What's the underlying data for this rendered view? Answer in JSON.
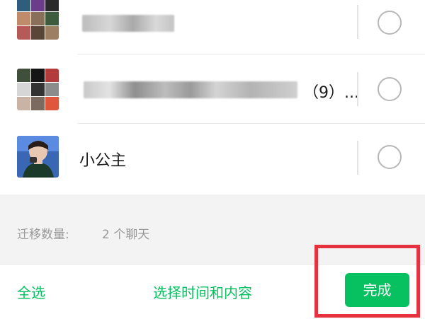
{
  "chat_list": {
    "items": [
      {
        "name": "",
        "selected": false,
        "avatar": "group-avatar-grid"
      },
      {
        "name": "（9）...",
        "selected": false,
        "avatar": "group-avatar-grid"
      },
      {
        "name": "小公主",
        "selected": false,
        "avatar": "user-avatar-photo"
      }
    ]
  },
  "footer": {
    "count_label": "迁移数量:",
    "count_value": "2 个聊天",
    "select_all": "全选",
    "select_time": "选择时间和内容",
    "done": "完成"
  },
  "colors": {
    "accent": "#07c160",
    "highlight": "#e6323e"
  }
}
